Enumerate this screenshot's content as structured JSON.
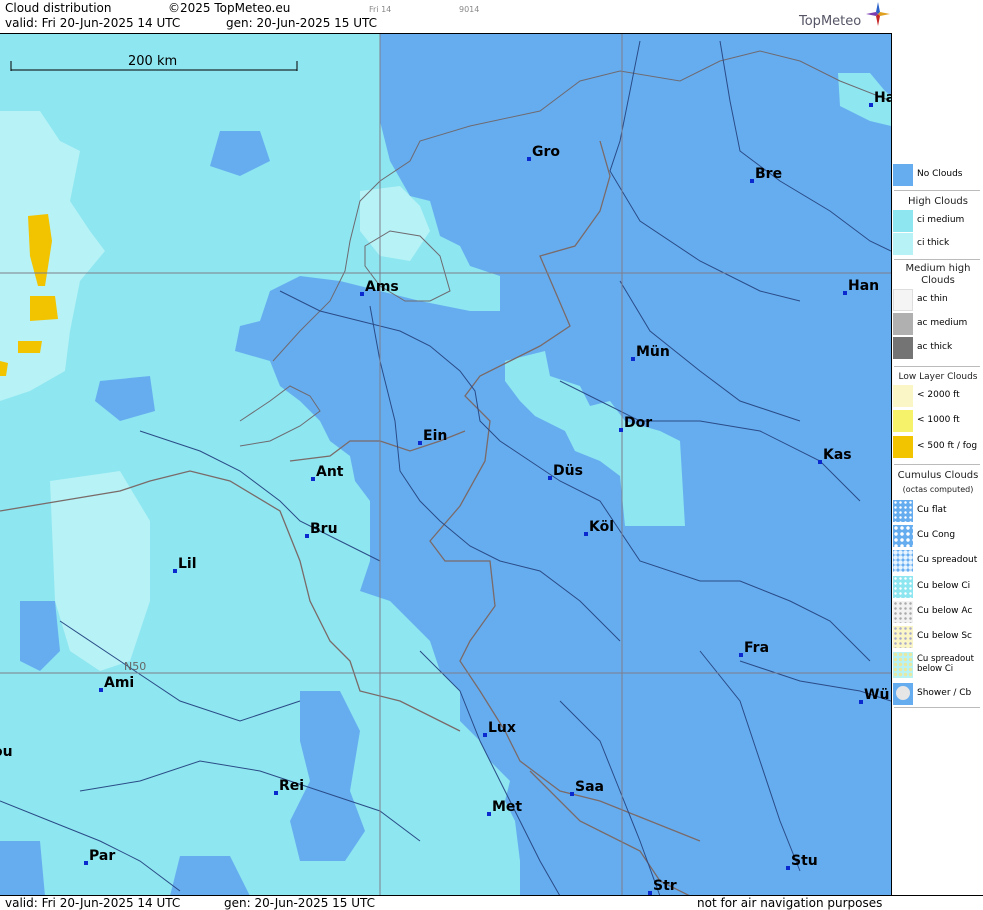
{
  "header": {
    "product": "Cloud distribution",
    "copyright": "©2025 TopMeteo.eu",
    "valid_line": "valid:  Fri  20-Jun-2025  14 UTC",
    "gen_line": "gen: 20-Jun-2025 15 UTC",
    "frame_day": "Fri 14",
    "frame_code": "9014",
    "brand": "TopMeteo"
  },
  "footer": {
    "valid_line": "valid:  Fri  20-Jun-2025  14 UTC",
    "gen_line": "gen: 20-Jun-2025 15 UTC",
    "disclaimer": "not for air navigation purposes"
  },
  "map": {
    "scale_label": "200 km",
    "grid_label": "N50",
    "colors": {
      "no_clouds": "#66adf0",
      "ci_medium": "#8ee6f0",
      "ci_thick": "#b6f2f6",
      "low_fog": "#f2c400",
      "rivers": "#2a4b86",
      "borders": "#7a6a68",
      "grid": "#7d7d8a"
    },
    "cities": [
      {
        "label": "Ha"
      },
      {
        "label": "Gro"
      },
      {
        "label": "Bre"
      },
      {
        "label": "Ams"
      },
      {
        "label": "Han"
      },
      {
        "label": "Mün"
      },
      {
        "label": "Ein"
      },
      {
        "label": "Dor"
      },
      {
        "label": "Ant"
      },
      {
        "label": "Düs"
      },
      {
        "label": "Kas"
      },
      {
        "label": "Bru"
      },
      {
        "label": "Köl"
      },
      {
        "label": "Lil"
      },
      {
        "label": "Fra"
      },
      {
        "label": "Ami"
      },
      {
        "label": "Lux"
      },
      {
        "label": "Wü"
      },
      {
        "label": "ou"
      },
      {
        "label": "Rei"
      },
      {
        "label": "Saa"
      },
      {
        "label": "Met"
      },
      {
        "label": "Par"
      },
      {
        "label": "Stu"
      },
      {
        "label": "Str"
      }
    ]
  },
  "legend": {
    "no_clouds": "No Clouds",
    "high_head": "High Clouds",
    "ci_medium": "ci medium",
    "ci_thick": "ci thick",
    "medium_head": "Medium high Clouds",
    "ac_thin": "ac thin",
    "ac_medium": "ac medium",
    "ac_thick": "ac thick",
    "low_head": "Low Layer Clouds",
    "low_2000": "< 2000 ft",
    "low_1000": "< 1000 ft",
    "low_500": "< 500 ft / fog",
    "cumulus_head": "Cumulus Clouds",
    "cumulus_sub": "(octas computed)",
    "cu_flat": "Cu flat",
    "cu_cong": "Cu Cong",
    "cu_spreadout": "Cu spreadout",
    "cu_below_ci": "Cu below Ci",
    "cu_below_ac": "Cu below Ac",
    "cu_below_sc": "Cu below Sc",
    "cu_spread_below_ci": "Cu spreadout below Ci",
    "shower": "Shower / Cb"
  }
}
